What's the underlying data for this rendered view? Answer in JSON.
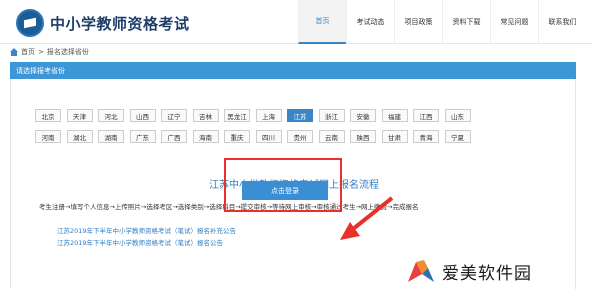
{
  "header": {
    "site_title": "中小学教师资格考试",
    "nav": [
      "首页",
      "考试动态",
      "项目政策",
      "资料下载",
      "常见问题",
      "联系我们"
    ]
  },
  "breadcrumb": {
    "home": "首页",
    "sep": ">",
    "current": "报名选择省份"
  },
  "section_title": "请选择报考省份",
  "provinces_row1": [
    "北京",
    "天津",
    "河北",
    "山西",
    "辽宁",
    "吉林",
    "黑龙江",
    "上海",
    "江苏",
    "浙江",
    "安徽",
    "福建",
    "江西",
    "山东"
  ],
  "provinces_row2": [
    "河南",
    "湖北",
    "湖南",
    "广东",
    "广西",
    "海南",
    "重庆",
    "四川",
    "贵州",
    "云南",
    "陕西",
    "甘肃",
    "青海",
    "宁夏"
  ],
  "selected_province": "江苏",
  "process": {
    "title": "江苏中小学教师资格考试网上报名流程",
    "steps": "考生注册→填写个人信息→上传照片→选择考区→选择类别→选择科目→提交审核→等待网上审核→审核通过考生→网上缴费→完成报名"
  },
  "notices": [
    "江苏2019年下半年中小学教师资格考试（笔试）报名补充公告",
    "江苏2019年下半年中小学教师资格考试（笔试）报名公告"
  ],
  "login_button": "点击登录",
  "watermark": "爱美软件园",
  "colors": {
    "accent": "#3a86c8",
    "bar": "#3d96d6",
    "highlight": "#e8312a"
  }
}
